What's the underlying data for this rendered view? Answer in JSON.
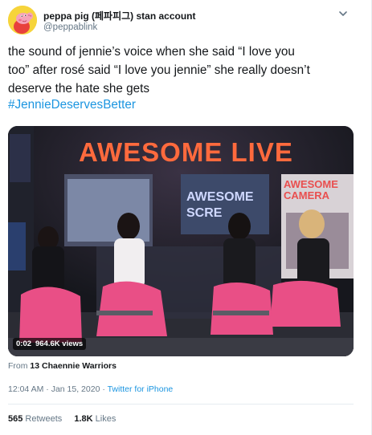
{
  "tweet": {
    "display_name": "peppa pig (페파피그) stan account",
    "handle": "@peppablink",
    "text_lines": [
      "the sound of jennie’s voice when she said “I love you",
      "too” after rosé said “I love you jennie” she really doesn’t",
      "deserve the hate she gets"
    ],
    "hashtag": "#JennieDeservesBetter"
  },
  "media": {
    "sign_main": "AWESOME LIVE",
    "sign_camera": "AWESOME CAMERA",
    "sign_screen_top": "AWESOME",
    "sign_screen_bottom": "SCRE",
    "elapsed": "0:02",
    "views": "964.6K views"
  },
  "meta": {
    "from_label": "From",
    "from_name": "13 Chaennie Warriors",
    "timestamp": "12:04 AM · Jan 15, 2020 ·",
    "source": "Twitter for iPhone",
    "retweets_count": "565",
    "retweets_label": "Retweets",
    "likes_count": "1.8K",
    "likes_label": "Likes"
  },
  "colors": {
    "link": "#1b95e0",
    "neon": "#ff6a3d",
    "skirt": "#e94f86"
  },
  "icons": {
    "avatar": "peppa-pig-avatar",
    "caret": "chevron-down-icon"
  }
}
